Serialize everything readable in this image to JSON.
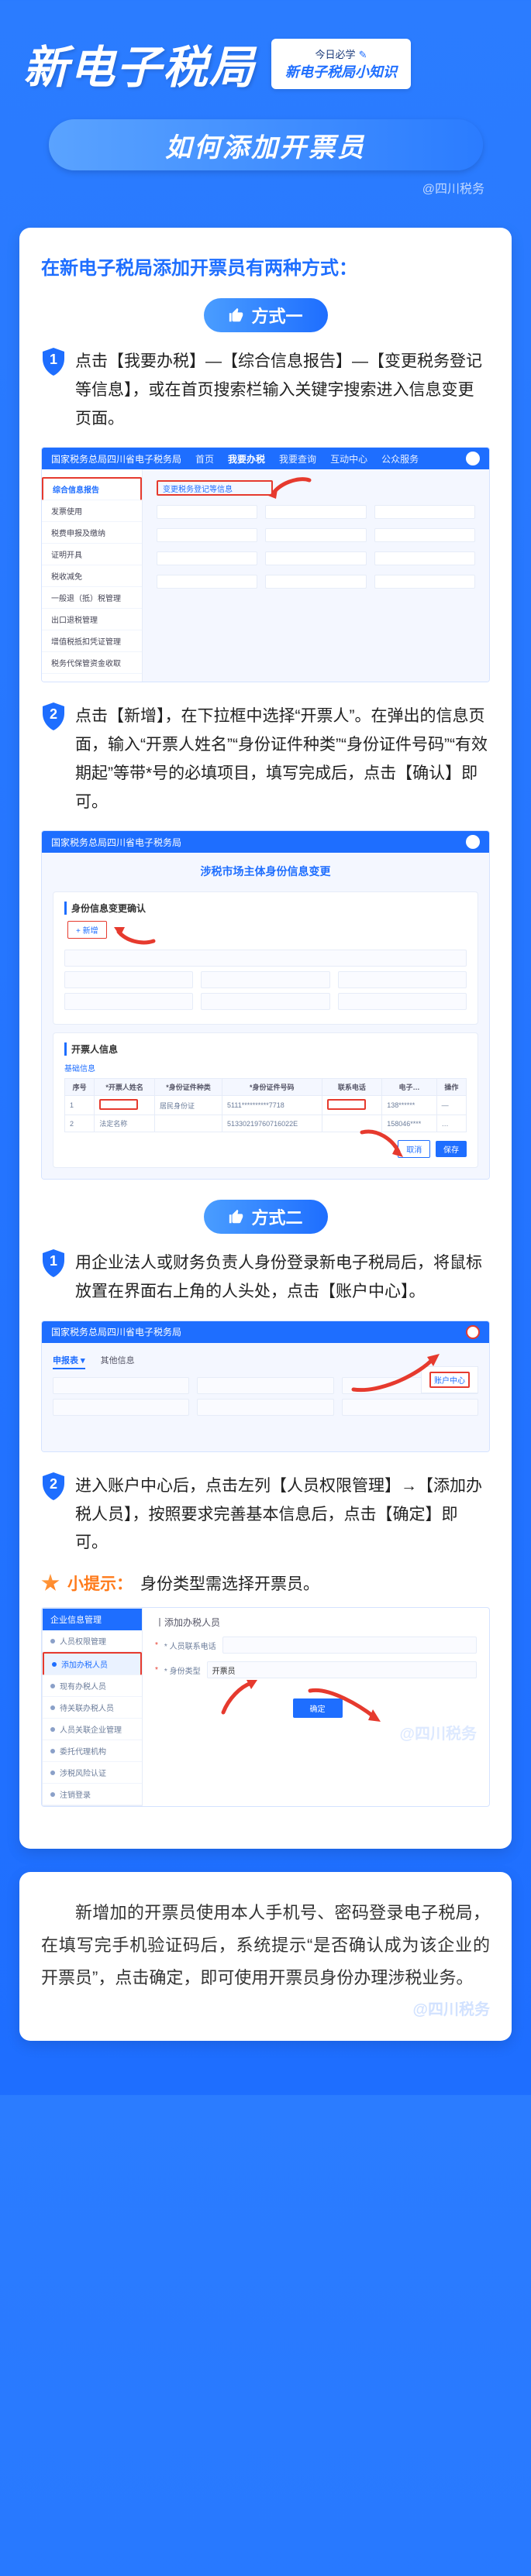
{
  "header": {
    "title": "新电子税局",
    "badge_top": "今日必学",
    "badge_bottom": "新电子税局小知识",
    "subtitle": "如何添加开票员",
    "watermark": "@四川税务"
  },
  "card1": {
    "intro": "在新电子税局添加开票员有两种方式：",
    "method1_label": "方式一",
    "step1_num": "1",
    "step1_text": "点击【我要办税】—【综合信息报告】—【变更税务登记等信息】，或在首页搜索栏输入关键字搜索进入信息变更页面。",
    "shot1": {
      "site_title": "国家税务总局四川省电子税务局",
      "nav": [
        "首页",
        "我要办税",
        "我要查询",
        "互动中心",
        "公众服务"
      ],
      "nav_active": "我要办税",
      "sidebar_hl": "综合信息报告",
      "sidebar": [
        "综合信息报告",
        "发票使用",
        "税费申报及缴纳",
        "证明开具",
        "税收减免",
        "一般退（抵）税管理",
        "出口退税管理",
        "增值税抵扣凭证管理",
        "税务代保管资金收取"
      ],
      "main_hl": "变更税务登记等信息"
    },
    "step2_num": "2",
    "step2_text": "点击【新增】，在下拉框中选择“开票人”。在弹出的信息页面，输入“开票人姓名”“身份证件种类”“身份证件号码”“有效期起”等带*号的必填项目，填写完成后，点击【确认】即可。",
    "shot2": {
      "site_title": "国家税务总局四川省电子税务局",
      "page_title": "涉税市场主体身份信息变更",
      "panel1_title": "身份信息变更确认",
      "btn_add": "+ 新增",
      "panel2_title": "开票人信息",
      "panel2_sub": "基础信息",
      "table_headers": [
        "序号",
        "*开票人姓名",
        "*身份证件种类",
        "*身份证件号码",
        "联系电话",
        "电子…",
        "操作"
      ],
      "rows": [
        [
          "1",
          "",
          "居民身份证",
          "5111**********7718",
          "",
          "138******",
          "—"
        ],
        [
          "2",
          "法定名称",
          "",
          "51330219760716022E",
          "",
          "158046****",
          "…"
        ]
      ],
      "btn_cancel": "取消",
      "btn_save": "保存"
    },
    "method2_label": "方式二",
    "m2_step1_num": "1",
    "m2_step1_text": "用企业法人或财务负责人身份登录新电子税局后，将鼠标放置在界面右上角的人头处，点击【账户中心】。",
    "shot3": {
      "site_title": "国家税务总局四川省电子税务局",
      "tabs": [
        "申报表 ▾",
        "其他信息"
      ],
      "label": "账户中心"
    },
    "m2_step2_num": "2",
    "m2_step2_text": "进入账户中心后，点击左列【人员权限管理】→【添加办税人员】，按照要求完善基本信息后，点击【确定】即可。",
    "tip_label": "小提示：",
    "tip_text": "身份类型需选择开票员。",
    "shot4": {
      "side_header": "企业信息管理",
      "side_items": [
        "人员权限管理",
        "添加办税人员",
        "现有办税人员",
        "待关联办税人员",
        "人员关联企业管理",
        "委托代理机构",
        "涉税风险认证",
        "注销登录"
      ],
      "side_hl": "添加办税人员",
      "main_title": "丨添加办税人员",
      "field1": "* 人员联系电话",
      "field2": "* 身份类型",
      "field_val": "开票员",
      "btn_ok": "确定",
      "wm": "@四川税务"
    }
  },
  "card2": {
    "para": "新增加的开票员使用本人手机号、密码登录电子税局，在填写完手机验证码后，系统提示“是否确认成为该企业的开票员”，点击确定，即可使用开票员身份办理涉税业务。",
    "wm": "@四川税务"
  }
}
